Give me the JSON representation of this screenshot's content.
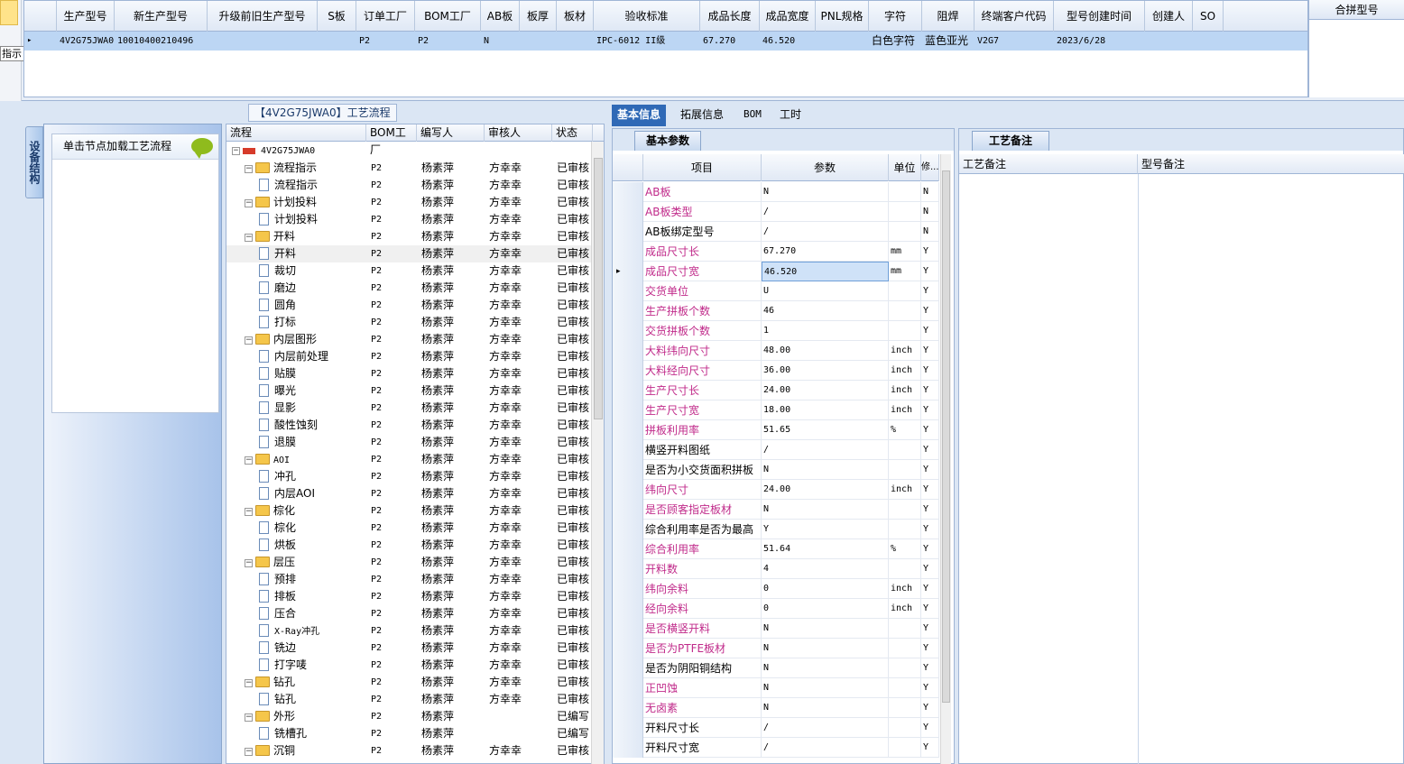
{
  "top_grid": {
    "tooltip": "指示",
    "columns": [
      "生产型号",
      "新生产型号",
      "升级前旧生产型号",
      "S板",
      "订单工厂",
      "BOM工厂",
      "AB板",
      "板厚",
      "板材",
      "验收标准",
      "成品长度",
      "成品宽度",
      "PNL规格",
      "字符",
      "阻焊",
      "终端客户代码",
      "型号创建时间",
      "创建人",
      "SO"
    ],
    "row": [
      "4V2G75JWA0",
      "10010400210496",
      "",
      "",
      "P2",
      "P2",
      "N",
      "",
      "",
      "IPC-6012 II级",
      "67.270",
      "46.520",
      "",
      "白色字符",
      "蓝色亚光",
      "V2G7",
      "2023/6/28",
      "",
      ""
    ],
    "merge_header": "合拼型号"
  },
  "left_panel": {
    "vertical_tab": "设备结构",
    "load_hint": "单击节点加载工艺流程"
  },
  "tree": {
    "title": "【4V2G75JWA0】工艺流程",
    "columns": [
      "流程",
      "BOM工厂",
      "编写人",
      "审核人",
      "状态"
    ],
    "root": "4V2G75JWA0",
    "rows": [
      {
        "level": 1,
        "type": "folder",
        "name": "流程指示",
        "bom": "P2",
        "writer": "杨素萍",
        "reviewer": "方幸幸",
        "status": "已审核"
      },
      {
        "level": 2,
        "type": "doc",
        "name": "流程指示",
        "bom": "P2",
        "writer": "杨素萍",
        "reviewer": "方幸幸",
        "status": "已审核"
      },
      {
        "level": 1,
        "type": "folder",
        "name": "计划投料",
        "bom": "P2",
        "writer": "杨素萍",
        "reviewer": "方幸幸",
        "status": "已审核"
      },
      {
        "level": 2,
        "type": "doc",
        "name": "计划投料",
        "bom": "P2",
        "writer": "杨素萍",
        "reviewer": "方幸幸",
        "status": "已审核"
      },
      {
        "level": 1,
        "type": "folder",
        "name": "开料",
        "bom": "P2",
        "writer": "杨素萍",
        "reviewer": "方幸幸",
        "status": "已审核"
      },
      {
        "level": 2,
        "type": "doc",
        "name": "开料",
        "bom": "P2",
        "writer": "杨素萍",
        "reviewer": "方幸幸",
        "status": "已审核",
        "selected": true
      },
      {
        "level": 2,
        "type": "doc",
        "name": "裁切",
        "bom": "P2",
        "writer": "杨素萍",
        "reviewer": "方幸幸",
        "status": "已审核"
      },
      {
        "level": 2,
        "type": "doc",
        "name": "磨边",
        "bom": "P2",
        "writer": "杨素萍",
        "reviewer": "方幸幸",
        "status": "已审核"
      },
      {
        "level": 2,
        "type": "doc",
        "name": "圆角",
        "bom": "P2",
        "writer": "杨素萍",
        "reviewer": "方幸幸",
        "status": "已审核"
      },
      {
        "level": 2,
        "type": "doc",
        "name": "打标",
        "bom": "P2",
        "writer": "杨素萍",
        "reviewer": "方幸幸",
        "status": "已审核"
      },
      {
        "level": 1,
        "type": "folder",
        "name": "内层图形",
        "bom": "P2",
        "writer": "杨素萍",
        "reviewer": "方幸幸",
        "status": "已审核"
      },
      {
        "level": 2,
        "type": "doc",
        "name": "内层前处理",
        "bom": "P2",
        "writer": "杨素萍",
        "reviewer": "方幸幸",
        "status": "已审核"
      },
      {
        "level": 2,
        "type": "doc",
        "name": "贴膜",
        "bom": "P2",
        "writer": "杨素萍",
        "reviewer": "方幸幸",
        "status": "已审核"
      },
      {
        "level": 2,
        "type": "doc",
        "name": "曝光",
        "bom": "P2",
        "writer": "杨素萍",
        "reviewer": "方幸幸",
        "status": "已审核"
      },
      {
        "level": 2,
        "type": "doc",
        "name": "显影",
        "bom": "P2",
        "writer": "杨素萍",
        "reviewer": "方幸幸",
        "status": "已审核"
      },
      {
        "level": 2,
        "type": "doc",
        "name": "酸性蚀刻",
        "bom": "P2",
        "writer": "杨素萍",
        "reviewer": "方幸幸",
        "status": "已审核"
      },
      {
        "level": 2,
        "type": "doc",
        "name": "退膜",
        "bom": "P2",
        "writer": "杨素萍",
        "reviewer": "方幸幸",
        "status": "已审核"
      },
      {
        "level": 1,
        "type": "folder",
        "name": "AOI",
        "bom": "P2",
        "writer": "杨素萍",
        "reviewer": "方幸幸",
        "status": "已审核"
      },
      {
        "level": 2,
        "type": "doc",
        "name": "冲孔",
        "bom": "P2",
        "writer": "杨素萍",
        "reviewer": "方幸幸",
        "status": "已审核"
      },
      {
        "level": 2,
        "type": "doc",
        "name": "内层AOI",
        "bom": "P2",
        "writer": "杨素萍",
        "reviewer": "方幸幸",
        "status": "已审核"
      },
      {
        "level": 1,
        "type": "folder",
        "name": "棕化",
        "bom": "P2",
        "writer": "杨素萍",
        "reviewer": "方幸幸",
        "status": "已审核"
      },
      {
        "level": 2,
        "type": "doc",
        "name": "棕化",
        "bom": "P2",
        "writer": "杨素萍",
        "reviewer": "方幸幸",
        "status": "已审核"
      },
      {
        "level": 2,
        "type": "doc",
        "name": "烘板",
        "bom": "P2",
        "writer": "杨素萍",
        "reviewer": "方幸幸",
        "status": "已审核"
      },
      {
        "level": 1,
        "type": "folder",
        "name": "层压",
        "bom": "P2",
        "writer": "杨素萍",
        "reviewer": "方幸幸",
        "status": "已审核"
      },
      {
        "level": 2,
        "type": "doc",
        "name": "预排",
        "bom": "P2",
        "writer": "杨素萍",
        "reviewer": "方幸幸",
        "status": "已审核"
      },
      {
        "level": 2,
        "type": "doc",
        "name": "排板",
        "bom": "P2",
        "writer": "杨素萍",
        "reviewer": "方幸幸",
        "status": "已审核"
      },
      {
        "level": 2,
        "type": "doc",
        "name": "压合",
        "bom": "P2",
        "writer": "杨素萍",
        "reviewer": "方幸幸",
        "status": "已审核"
      },
      {
        "level": 2,
        "type": "doc",
        "name": "X-Ray冲孔",
        "bom": "P2",
        "writer": "杨素萍",
        "reviewer": "方幸幸",
        "status": "已审核"
      },
      {
        "level": 2,
        "type": "doc",
        "name": "铣边",
        "bom": "P2",
        "writer": "杨素萍",
        "reviewer": "方幸幸",
        "status": "已审核"
      },
      {
        "level": 2,
        "type": "doc",
        "name": "打字唛",
        "bom": "P2",
        "writer": "杨素萍",
        "reviewer": "方幸幸",
        "status": "已审核"
      },
      {
        "level": 1,
        "type": "folder",
        "name": "钻孔",
        "bom": "P2",
        "writer": "杨素萍",
        "reviewer": "方幸幸",
        "status": "已审核"
      },
      {
        "level": 2,
        "type": "doc",
        "name": "钻孔",
        "bom": "P2",
        "writer": "杨素萍",
        "reviewer": "方幸幸",
        "status": "已审核"
      },
      {
        "level": 1,
        "type": "folder",
        "name": "外形",
        "bom": "P2",
        "writer": "杨素萍",
        "reviewer": "",
        "status": "已编写"
      },
      {
        "level": 2,
        "type": "doc",
        "name": "铣槽孔",
        "bom": "P2",
        "writer": "杨素萍",
        "reviewer": "",
        "status": "已编写"
      },
      {
        "level": 1,
        "type": "folder",
        "name": "沉铜",
        "bom": "P2",
        "writer": "杨素萍",
        "reviewer": "方幸幸",
        "status": "已审核"
      }
    ]
  },
  "tabs": [
    "基本信息",
    "拓展信息",
    "BOM",
    "工时"
  ],
  "basic": {
    "subtab": "基本参数",
    "columns": [
      "项目",
      "参数",
      "单位",
      "修..."
    ],
    "rows": [
      {
        "item": "AB板",
        "value": "N",
        "unit": "",
        "mod": "N",
        "pink": true
      },
      {
        "item": "AB板类型",
        "value": "/",
        "unit": "",
        "mod": "N",
        "pink": true
      },
      {
        "item": "AB板绑定型号",
        "value": "/",
        "unit": "",
        "mod": "N",
        "pink": false
      },
      {
        "item": "成品尺寸长",
        "value": "67.270",
        "unit": "mm",
        "mod": "Y",
        "pink": true
      },
      {
        "item": "成品尺寸宽",
        "value": "46.520",
        "unit": "mm",
        "mod": "Y",
        "pink": true,
        "current": true
      },
      {
        "item": "交货单位",
        "value": "U",
        "unit": "",
        "mod": "Y",
        "pink": true
      },
      {
        "item": "生产拼板个数",
        "value": "46",
        "unit": "",
        "mod": "Y",
        "pink": true
      },
      {
        "item": "交货拼板个数",
        "value": "1",
        "unit": "",
        "mod": "Y",
        "pink": true
      },
      {
        "item": "大料纬向尺寸",
        "value": "48.00",
        "unit": "inch",
        "mod": "Y",
        "pink": true
      },
      {
        "item": "大料经向尺寸",
        "value": "36.00",
        "unit": "inch",
        "mod": "Y",
        "pink": true
      },
      {
        "item": "生产尺寸长",
        "value": "24.00",
        "unit": "inch",
        "mod": "Y",
        "pink": true
      },
      {
        "item": "生产尺寸宽",
        "value": "18.00",
        "unit": "inch",
        "mod": "Y",
        "pink": true
      },
      {
        "item": "拼板利用率",
        "value": "51.65",
        "unit": "%",
        "mod": "Y",
        "pink": true
      },
      {
        "item": "横竖开料图纸",
        "value": "/",
        "unit": "",
        "mod": "Y",
        "pink": false
      },
      {
        "item": "是否为小交货面积拼板",
        "value": "N",
        "unit": "",
        "mod": "Y",
        "pink": false
      },
      {
        "item": "纬向尺寸",
        "value": "24.00",
        "unit": "inch",
        "mod": "Y",
        "pink": true
      },
      {
        "item": "是否顾客指定板材",
        "value": "N",
        "unit": "",
        "mod": "Y",
        "pink": true
      },
      {
        "item": "综合利用率是否为最高",
        "value": "Y",
        "unit": "",
        "mod": "Y",
        "pink": false
      },
      {
        "item": "综合利用率",
        "value": "51.64",
        "unit": "%",
        "mod": "Y",
        "pink": true
      },
      {
        "item": "开料数",
        "value": "4",
        "unit": "",
        "mod": "Y",
        "pink": true
      },
      {
        "item": "纬向余料",
        "value": "0",
        "unit": "inch",
        "mod": "Y",
        "pink": true
      },
      {
        "item": "经向余料",
        "value": "0",
        "unit": "inch",
        "mod": "Y",
        "pink": true
      },
      {
        "item": "是否横竖开料",
        "value": "N",
        "unit": "",
        "mod": "Y",
        "pink": true
      },
      {
        "item": "是否为PTFE板材",
        "value": "N",
        "unit": "",
        "mod": "Y",
        "pink": true
      },
      {
        "item": "是否为阴阳铜结构",
        "value": "N",
        "unit": "",
        "mod": "Y",
        "pink": false
      },
      {
        "item": "正凹蚀",
        "value": "N",
        "unit": "",
        "mod": "Y",
        "pink": true
      },
      {
        "item": "无卤素",
        "value": "N",
        "unit": "",
        "mod": "Y",
        "pink": true
      },
      {
        "item": "开料尺寸长",
        "value": "/",
        "unit": "",
        "mod": "Y",
        "pink": false
      },
      {
        "item": "开料尺寸宽",
        "value": "/",
        "unit": "",
        "mod": "Y",
        "pink": false
      }
    ]
  },
  "notes": {
    "subtab": "工艺备注",
    "col1": "工艺备注",
    "col2": "型号备注"
  },
  "colors": {
    "selected_row": "#bcd6f4",
    "accent": "#2f69b6",
    "pink_text": "#c02a8a"
  }
}
